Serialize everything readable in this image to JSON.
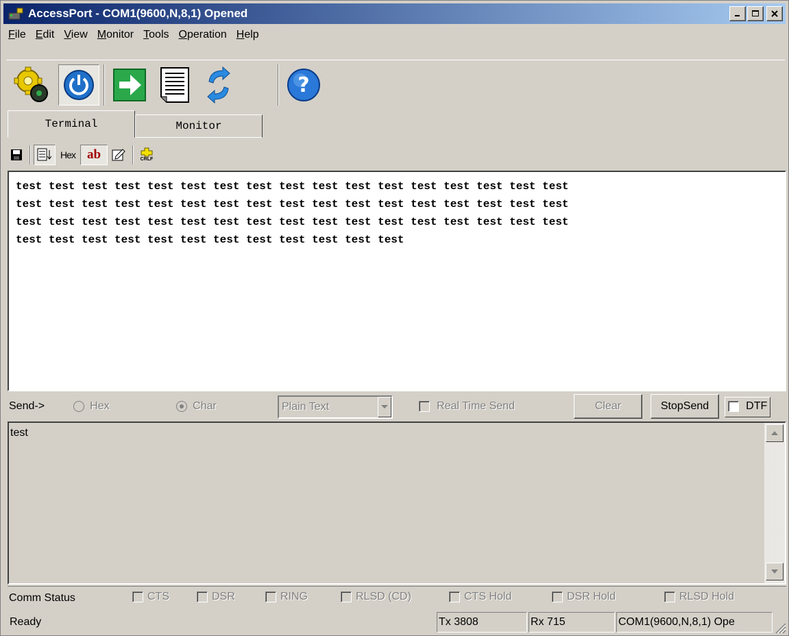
{
  "window": {
    "title": "AccessPort - COM1(9600,N,8,1) Opened",
    "icon": "plug-icon"
  },
  "menu": {
    "items": [
      {
        "accel": "F",
        "rest": "ile"
      },
      {
        "accel": "E",
        "rest": "dit"
      },
      {
        "accel": "V",
        "rest": "iew"
      },
      {
        "accel": "M",
        "rest": "onitor"
      },
      {
        "accel": "T",
        "rest": "ools"
      },
      {
        "accel": "O",
        "rest": "peration"
      },
      {
        "accel": "H",
        "rest": "elp"
      }
    ]
  },
  "toolbar": {
    "buttons": [
      "gears-icon",
      "power-icon",
      "arrow-right-icon",
      "document-icon",
      "refresh-icon",
      "help-icon"
    ],
    "pressed": "power-icon"
  },
  "tabs": {
    "terminal": "Terminal",
    "monitor": "Monitor",
    "active": "Terminal"
  },
  "small_toolbar": {
    "hex_label": "Hex",
    "ab_label": "ab",
    "crlf_label": "CRLF"
  },
  "terminal": {
    "lines": [
      "test test test test test test test test test test test test test test test test test",
      "test test test test test test test test test test test test test test test test test",
      "test test test test test test test test test test test test test test test test test",
      "test test test test test test test test test test test test"
    ]
  },
  "send_bar": {
    "label": "Send->",
    "hex": "Hex",
    "char": "Char",
    "char_selected": true,
    "mode": "Plain Text",
    "real_time_send": "Real Time Send",
    "clear": "Clear",
    "stop_send": "StopSend",
    "dtf": "DTF"
  },
  "send_area": {
    "text": "test"
  },
  "comm_status": {
    "label": "Comm Status",
    "signals": [
      "CTS",
      "DSR",
      "RING",
      "RLSD (CD)",
      "CTS Hold",
      "DSR Hold",
      "RLSD Hold"
    ]
  },
  "status_bar": {
    "state": "Ready",
    "tx": "Tx 3808",
    "rx": "Rx 715",
    "port": "COM1(9600,N,8,1) Ope"
  },
  "colors": {
    "title_start": "#0a246a",
    "title_end": "#a6caf0",
    "face": "#d4d0c8"
  }
}
